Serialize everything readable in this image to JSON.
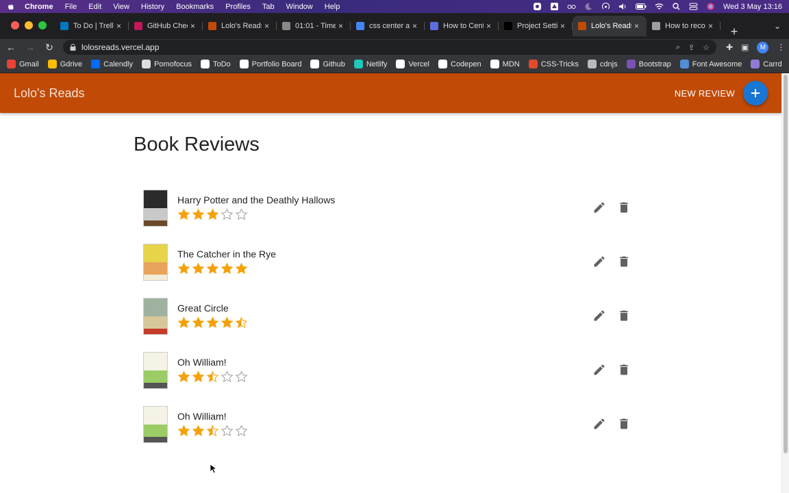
{
  "menubar": {
    "app": "Chrome",
    "items": [
      "File",
      "Edit",
      "View",
      "History",
      "Bookmarks",
      "Profiles",
      "Tab",
      "Window",
      "Help"
    ],
    "clock": "Wed 3 May  13:16"
  },
  "tabs": [
    {
      "title": "To Do | Trello",
      "color": "#0079bf"
    },
    {
      "title": "GitHub Check",
      "color": "#c2185b"
    },
    {
      "title": "Lolo's Reads",
      "color": "#c14a07"
    },
    {
      "title": "01:01 - Time",
      "color": "#888888"
    },
    {
      "title": "css center an",
      "color": "#4285f4"
    },
    {
      "title": "How to Cent",
      "color": "#5b6ee1"
    },
    {
      "title": "Project Setti",
      "color": "#000000"
    },
    {
      "title": "Lolo's Reads",
      "color": "#c14a07",
      "active": true
    },
    {
      "title": "How to reco",
      "color": "#9e9e9e"
    }
  ],
  "address": {
    "url": "lolosreads.vercel.app",
    "avatar": "M"
  },
  "bookmarks": [
    {
      "label": "Gmail",
      "color": "#ea4335"
    },
    {
      "label": "Gdrive",
      "color": "#fbbc04"
    },
    {
      "label": "Calendly",
      "color": "#006bff"
    },
    {
      "label": "Pomofocus",
      "color": "#dddddd"
    },
    {
      "label": "ToDo",
      "color": "#ffffff"
    },
    {
      "label": "Portfolio Board",
      "color": "#ffffff"
    },
    {
      "label": "Github",
      "color": "#ffffff"
    },
    {
      "label": "Netlify",
      "color": "#20c6b7"
    },
    {
      "label": "Vercel",
      "color": "#ffffff"
    },
    {
      "label": "Codepen",
      "color": "#ffffff"
    },
    {
      "label": "MDN",
      "color": "#ffffff"
    },
    {
      "label": "CSS-Tricks",
      "color": "#e24a2b"
    },
    {
      "label": "cdnjs",
      "color": "#bbbbbb"
    },
    {
      "label": "Bootstrap",
      "color": "#7952b3"
    },
    {
      "label": "Font Awesome",
      "color": "#538dd7"
    },
    {
      "label": "Carrd",
      "color": "#8f7bd6"
    }
  ],
  "app": {
    "title": "Lolo's Reads",
    "new_review_label": "NEW REVIEW",
    "heading": "Book Reviews",
    "accent": "#c14a07",
    "fab_color": "#1976d2",
    "star_color": "#f4a20c"
  },
  "reviews": [
    {
      "title": "Harry Potter and the Deathly Hallows",
      "rating": 3,
      "cover": [
        "#2b2b2b",
        "#c9c9c9",
        "#6b4a2a"
      ]
    },
    {
      "title": "The Catcher in the Rye",
      "rating": 5,
      "cover": [
        "#e8d44a",
        "#e8a35c",
        "#f3ecd8"
      ]
    },
    {
      "title": "Great Circle",
      "rating": 4.5,
      "cover": [
        "#9fb2a0",
        "#d7c79a",
        "#c43d2a"
      ]
    },
    {
      "title": "Oh William!",
      "rating": 2.5,
      "cover": [
        "#f5f3e6",
        "#9ccc65",
        "#555555"
      ]
    },
    {
      "title": "Oh William!",
      "rating": 2.5,
      "cover": [
        "#f5f3e6",
        "#9ccc65",
        "#555555"
      ]
    }
  ]
}
